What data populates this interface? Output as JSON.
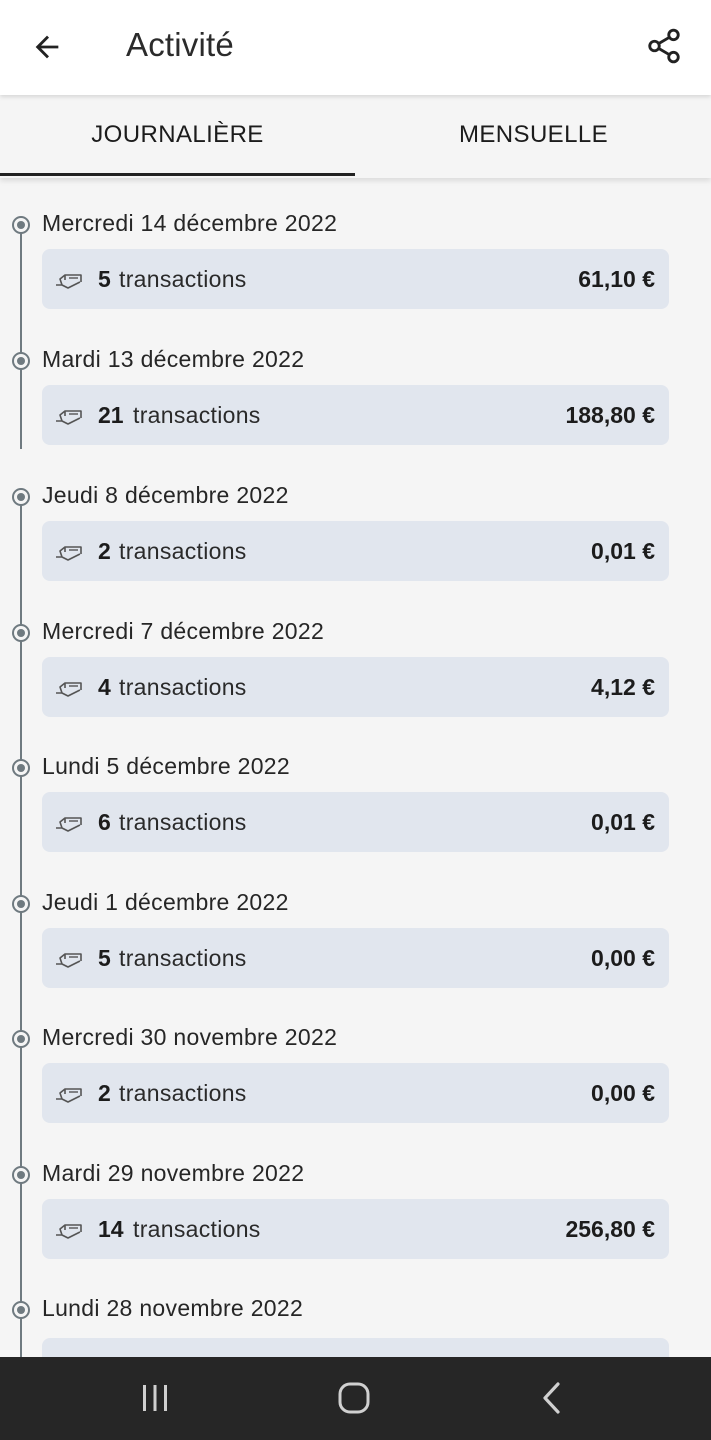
{
  "header": {
    "title": "Activité",
    "back_icon": "arrow-left-icon",
    "share_icon": "share-icon"
  },
  "tabs": [
    {
      "label": "JOURNALIÈRE",
      "selected": true
    },
    {
      "label": "MENSUELLE",
      "selected": false
    }
  ],
  "entries": [
    {
      "date": "Mercredi 14 décembre 2022",
      "count": "5",
      "label": "transactions",
      "amount": "61,10 €"
    },
    {
      "date": "Mardi 13 décembre 2022",
      "count": "21",
      "label": "transactions",
      "amount": "188,80 €"
    },
    {
      "date": "Jeudi 8 décembre 2022",
      "count": "2",
      "label": "transactions",
      "amount": "0,01 €"
    },
    {
      "date": "Mercredi 7 décembre 2022",
      "count": "4",
      "label": "transactions",
      "amount": "4,12 €"
    },
    {
      "date": "Lundi 5 décembre 2022",
      "count": "6",
      "label": "transactions",
      "amount": "0,01 €"
    },
    {
      "date": "Jeudi 1 décembre 2022",
      "count": "5",
      "label": "transactions",
      "amount": "0,00 €"
    },
    {
      "date": "Mercredi 30 novembre 2022",
      "count": "2",
      "label": "transactions",
      "amount": "0,00 €"
    },
    {
      "date": "Mardi 29 novembre 2022",
      "count": "14",
      "label": "transactions",
      "amount": "256,80 €"
    },
    {
      "date": "Lundi 28 novembre 2022"
    }
  ],
  "colors": {
    "card_bg": "#e1e6ee",
    "timeline": "#6f7a80",
    "page_bg": "#f5f5f5",
    "navbar": "#262626"
  },
  "navbar": {
    "icons": [
      "recent-apps-icon",
      "home-icon",
      "back-icon"
    ]
  }
}
